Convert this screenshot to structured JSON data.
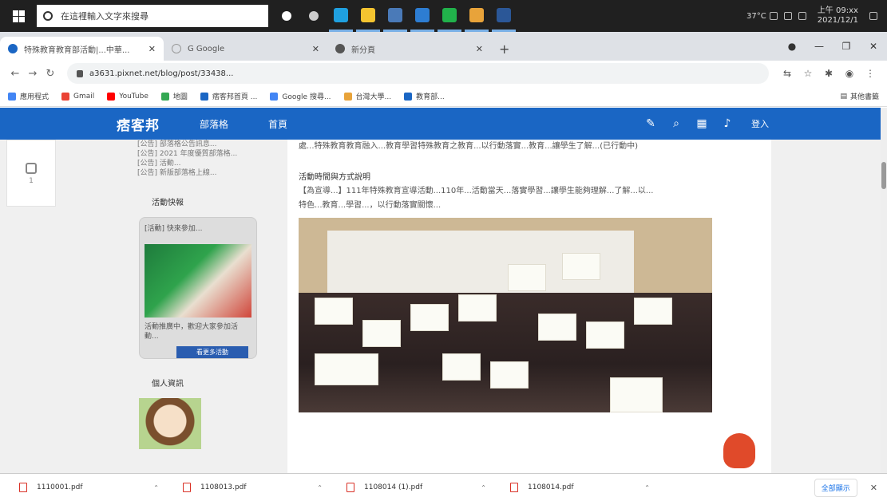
{
  "taskbar": {
    "search_placeholder": "在這裡輸入文字來搜尋",
    "apps": [
      {
        "name": "cortana",
        "color": "#ffffff"
      },
      {
        "name": "task-view",
        "color": "#cccccc"
      },
      {
        "name": "edge",
        "color": "#1fa0e0"
      },
      {
        "name": "file-explorer",
        "color": "#f4c430"
      },
      {
        "name": "store",
        "color": "#4a7ab8"
      },
      {
        "name": "mail",
        "color": "#2d7dd2"
      },
      {
        "name": "line",
        "color": "#21b24b"
      },
      {
        "name": "chrome",
        "color": "#e8a33a"
      },
      {
        "name": "word",
        "color": "#2b5797"
      }
    ],
    "temperature": "37°C",
    "time": "上午 09:xx",
    "date": "2021/12/1"
  },
  "tabs": [
    {
      "title": "特殊教育教育部活動|...中華...",
      "favicon_color": "#1a66c4"
    },
    {
      "title": "G Google",
      "favicon_color": "#ffffff"
    },
    {
      "title": "新分頁",
      "favicon_color": "#555555"
    }
  ],
  "address": {
    "url": "a3631.pixnet.net/blog/post/33438..."
  },
  "bookmarks": [
    {
      "label": "應用程式",
      "color": "#4285f4"
    },
    {
      "label": "Gmail",
      "color": "#ea4335"
    },
    {
      "label": "YouTube",
      "color": "#ff0000"
    },
    {
      "label": "地圖",
      "color": "#34a853"
    },
    {
      "label": "痞客邦首頁 ...",
      "color": "#1a66c4"
    },
    {
      "label": "Google 搜尋...",
      "color": "#4285f4"
    },
    {
      "label": "台灣大學...",
      "color": "#e8a33a"
    },
    {
      "label": "教育部...",
      "color": "#1a66c4"
    }
  ],
  "other_bookmarks": "其他書籤",
  "site": {
    "logo": "痞客邦",
    "nav": [
      "部落格",
      "首頁"
    ],
    "login": "登入",
    "share_count": "1",
    "sidebar": {
      "links": [
        "[公告] 部落格公告訊息...",
        "[公告] 2021 年度優質部落格...",
        "[公告] 活動...",
        "[公告] 新版部落格上線..."
      ],
      "activity_title": "活動快報",
      "ad_caption": "[活動] 快來參加...",
      "ad_text": "活動推廣中，歡迎大家參加活動...",
      "ad_button": "看更多活動",
      "popular_title": "個人資訊"
    },
    "article": {
      "para1": "處...特殊教育教育融入...教育學習特殊教育之教育...以行動落實...教育...讓學生了解...(已行動中)",
      "heading": "活動時間與方式說明",
      "para2": "【為宣導...】111年特殊教育宣導活動...110年...活動當天...落實學習...讓學生能夠理解...了解...以...",
      "para3": "特色...教育...學習...，以行動落實關懷..."
    }
  },
  "downloads": [
    "1110001.pdf",
    "1108013.pdf",
    "1108014 (1).pdf",
    "1108014.pdf"
  ],
  "show_all": "全部顯示"
}
